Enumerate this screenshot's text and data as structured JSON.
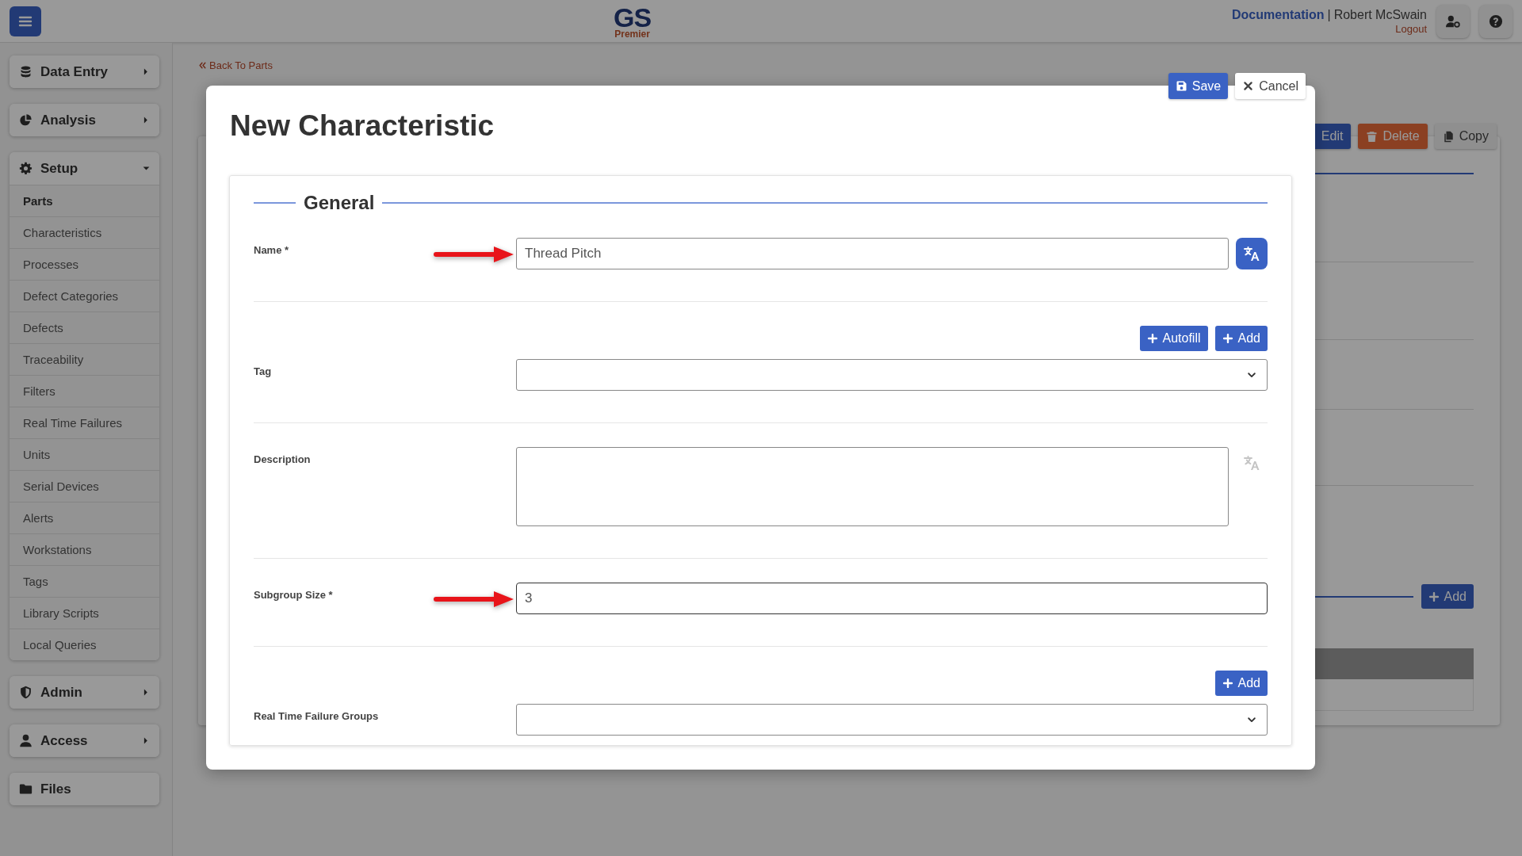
{
  "header": {
    "logo": {
      "mark": "GS",
      "subtitle": "Premier"
    },
    "documentation_link": "Documentation",
    "separator": "|",
    "user_name": "Robert McSwain",
    "logout_link": "Logout"
  },
  "sidebar": {
    "sections": [
      {
        "kind": "group",
        "label": "Data Entry",
        "expanded": false
      },
      {
        "kind": "group",
        "label": "Analysis",
        "expanded": false
      },
      {
        "kind": "group",
        "label": "Setup",
        "expanded": true,
        "items": [
          {
            "label": "Parts",
            "selected": true
          },
          {
            "label": "Characteristics",
            "selected": false
          },
          {
            "label": "Processes",
            "selected": false
          },
          {
            "label": "Defect Categories",
            "selected": false
          },
          {
            "label": "Defects",
            "selected": false
          },
          {
            "label": "Traceability",
            "selected": false
          },
          {
            "label": "Filters",
            "selected": false
          },
          {
            "label": "Real Time Failures",
            "selected": false
          },
          {
            "label": "Units",
            "selected": false
          },
          {
            "label": "Serial Devices",
            "selected": false
          },
          {
            "label": "Alerts",
            "selected": false
          },
          {
            "label": "Workstations",
            "selected": false
          },
          {
            "label": "Tags",
            "selected": false
          },
          {
            "label": "Library Scripts",
            "selected": false
          },
          {
            "label": "Local Queries",
            "selected": false
          }
        ]
      },
      {
        "kind": "group",
        "label": "Admin",
        "expanded": false
      },
      {
        "kind": "group",
        "label": "Access",
        "expanded": false
      },
      {
        "kind": "link",
        "label": "Files"
      }
    ]
  },
  "background_page": {
    "back_link": "Back To Parts",
    "buttons": [
      {
        "kind": "edit",
        "label": "Edit"
      },
      {
        "kind": "delete",
        "label": "Delete"
      },
      {
        "kind": "copy",
        "label": "Copy"
      }
    ],
    "add_button": "Add"
  },
  "dialog": {
    "title": "New Characteristic",
    "actions": [
      {
        "kind": "save",
        "label": "Save"
      },
      {
        "kind": "cancel",
        "label": "Cancel"
      }
    ],
    "section_title": "General",
    "fields": [
      {
        "kind": "text",
        "label": "Name *",
        "value": "Thread Pitch",
        "arrow": true,
        "focused": false,
        "translate": true,
        "translate_disabled": false
      },
      {
        "kind": "select",
        "label": "Tag",
        "buttons": [
          "Autofill",
          "Add"
        ]
      },
      {
        "kind": "textarea",
        "label": "Description",
        "translate": true,
        "translate_disabled": true
      },
      {
        "kind": "text",
        "label": "Subgroup Size *",
        "value": "3",
        "arrow": true,
        "focused": true
      },
      {
        "kind": "select",
        "label": "Real Time Failure Groups",
        "buttons": [
          "Add"
        ]
      }
    ]
  }
}
